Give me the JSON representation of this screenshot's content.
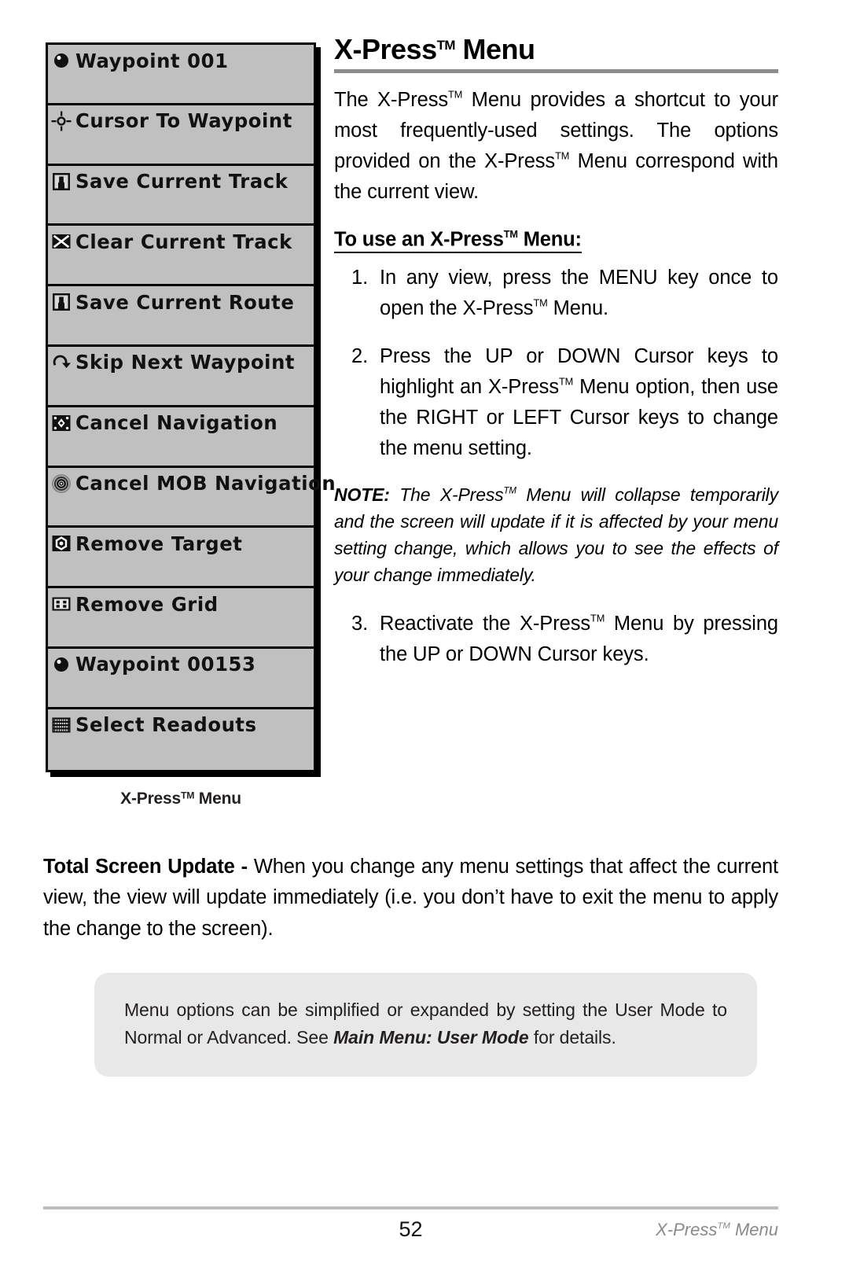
{
  "page": {
    "number": "52",
    "footer_right_text": "X-Press",
    "footer_right_sup": "TM",
    "footer_right_tail": " Menu"
  },
  "figure": {
    "caption_text": "X-Press",
    "caption_sup": "TM",
    "caption_tail": " Menu",
    "background_color": "#c0c0c0",
    "border_color": "#000000",
    "items": [
      {
        "label": "Waypoint 001",
        "icon": "waypoint-sphere-icon"
      },
      {
        "label": "Cursor To Waypoint",
        "icon": "crosshair-cursor-icon"
      },
      {
        "label": "Save Current Track",
        "icon": "floppy-save-icon"
      },
      {
        "label": "Clear Current Track",
        "icon": "x-clear-icon"
      },
      {
        "label": "Save Current Route",
        "icon": "floppy-save-icon"
      },
      {
        "label": "Skip Next Waypoint",
        "icon": "skip-arrow-icon"
      },
      {
        "label": "Cancel Navigation",
        "icon": "cancel-navigation-icon"
      },
      {
        "label": "Cancel MOB Navigation",
        "icon": "mob-target-icon"
      },
      {
        "label": "Remove Target",
        "icon": "remove-target-icon"
      },
      {
        "label": "Remove Grid",
        "icon": "remove-grid-icon"
      },
      {
        "label": "Waypoint 00153",
        "icon": "waypoint-sphere-icon"
      },
      {
        "label": "Select Readouts",
        "icon": "select-readouts-icon"
      }
    ]
  },
  "article": {
    "title_text": "X-Press",
    "title_sup": "TM",
    "title_tail": " Menu",
    "intro_part1": "The X-Press",
    "intro_sup1": "TM",
    "intro_part2": " Menu provides a shortcut to your most frequently-used settings. The options provided on the X-Press",
    "intro_sup2": "TM",
    "intro_part3": " Menu correspond with the current view.",
    "subhead_part1": "To use an X-Press",
    "subhead_sup": "TM",
    "subhead_part2": " Menu:",
    "steps": [
      {
        "number": "1.",
        "part1": "In any view, press the MENU key once to open the X-Press",
        "sup": "TM",
        "part2": " Menu."
      },
      {
        "number": "2.",
        "part1": "Press the UP or DOWN Cursor keys to highlight an X-Press",
        "sup": "TM",
        "part2": " Menu option, then use the RIGHT or LEFT Cursor keys to change the menu setting."
      },
      {
        "number": "3.",
        "part1": "Reactivate the X-Press",
        "sup": "TM",
        "part2": " Menu by pressing the UP or DOWN Cursor keys."
      }
    ],
    "note": {
      "lead": "NOTE:",
      "part1": " The X-Press",
      "sup": "TM",
      "part2": " Menu will collapse temporarily and the screen will update if it is affected by your menu setting change, which allows you to see the effects of your change immediately."
    },
    "total_update": {
      "lead": "Total Screen Update - ",
      "body": "When you change any menu settings that affect the current view, the view will update immediately (i.e. you don’t have to exit the menu to apply the change to the screen)."
    },
    "callout": {
      "part1": "Menu options can be simplified or expanded by setting the User Mode to Normal or Advanced. See ",
      "reference": "Main Menu: User Mode",
      "part2": " for details.",
      "background_color": "#e8e8e8"
    }
  }
}
